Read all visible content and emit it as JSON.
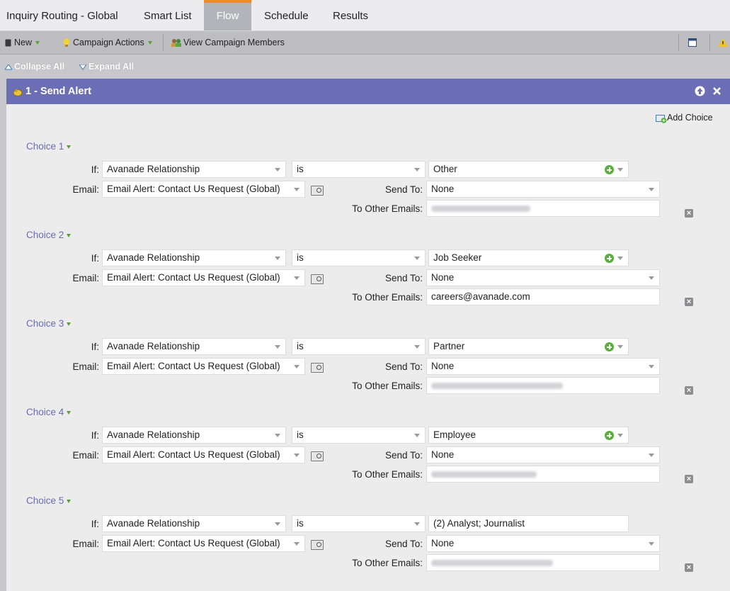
{
  "tabs": [
    {
      "label": "Inquiry Routing - Global",
      "active": false
    },
    {
      "label": "Smart List",
      "active": false
    },
    {
      "label": "Flow",
      "active": true
    },
    {
      "label": "Schedule",
      "active": false
    },
    {
      "label": "Results",
      "active": false
    }
  ],
  "toolbar": {
    "new_label": "New",
    "campaign_actions_label": "Campaign Actions",
    "view_members_label": "View Campaign Members"
  },
  "collapse_bar": {
    "collapse_label": "Collapse All",
    "expand_label": "Expand All"
  },
  "step": {
    "title": "1 - Send Alert",
    "add_choice_label": "Add Choice",
    "labels": {
      "if": "If:",
      "email": "Email:",
      "send_to": "Send To:",
      "to_other": "To Other Emails:"
    },
    "choices": [
      {
        "label": "Choice 1",
        "attribute": "Avanade Relationship",
        "operator": "is",
        "value": "Other",
        "value_has_plus": true,
        "email": "Email Alert: Contact Us Request (Global)",
        "send_to": "None",
        "to_other": "",
        "to_other_redacted": true
      },
      {
        "label": "Choice 2",
        "attribute": "Avanade Relationship",
        "operator": "is",
        "value": "Job Seeker",
        "value_has_plus": true,
        "email": "Email Alert: Contact Us Request (Global)",
        "send_to": "None",
        "to_other": "careers@avanade.com",
        "to_other_redacted": false
      },
      {
        "label": "Choice 3",
        "attribute": "Avanade Relationship",
        "operator": "is",
        "value": "Partner",
        "value_has_plus": true,
        "email": "Email Alert: Contact Us Request (Global)",
        "send_to": "None",
        "to_other": "",
        "to_other_redacted": true
      },
      {
        "label": "Choice 4",
        "attribute": "Avanade Relationship",
        "operator": "is",
        "value": "Employee",
        "value_has_plus": true,
        "email": "Email Alert: Contact Us Request (Global)",
        "send_to": "None",
        "to_other": "",
        "to_other_redacted": true
      },
      {
        "label": "Choice 5",
        "attribute": "Avanade Relationship",
        "operator": "is",
        "value": "(2) Analyst; Journalist",
        "value_has_plus": false,
        "email": "Email Alert: Contact Us Request (Global)",
        "send_to": "None",
        "to_other": "",
        "to_other_redacted": true
      }
    ]
  },
  "colors": {
    "accent_tab": "#f0892e",
    "panel_header": "#6c6eb5",
    "choice_label": "#6a6cb0",
    "plus_green": "#58ad3d"
  }
}
